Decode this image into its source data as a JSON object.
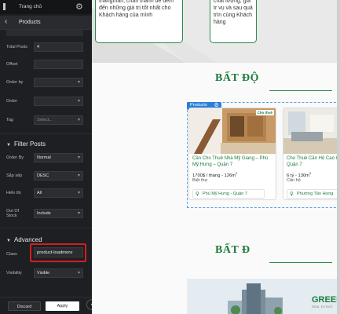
{
  "topbar": {
    "title": "Trang chủ",
    "gear": "gear-icon"
  },
  "panel": {
    "back_icon": "chevron-left-icon",
    "title": "Products"
  },
  "query": {
    "fields": [
      {
        "label": "Total Posts",
        "value": "4"
      },
      {
        "label": "Offset",
        "value": ""
      },
      {
        "label": "Order by",
        "value": ""
      },
      {
        "label": "Order",
        "value": ""
      },
      {
        "label": "Tag",
        "value": "Select..."
      }
    ]
  },
  "filter": {
    "title": "Filter Posts",
    "fields": [
      {
        "label": "Order By",
        "value": "Normal"
      },
      {
        "label": "Sắp xếp",
        "value": "DESC"
      },
      {
        "label": "Hiển thị",
        "value": "All"
      },
      {
        "label": "Out Of Stock",
        "value": "Include"
      }
    ]
  },
  "advanced": {
    "title": "Advanced",
    "class_label": "Class",
    "class_value": "product-loadmore",
    "visibility_label": "Visibility",
    "visibility_value": "Visible"
  },
  "footer": {
    "discard": "Discard",
    "apply": "Apply",
    "collapse_icon": "chevron-left-icon"
  },
  "canvas": {
    "card1_text": "thẳngthắn, chân thành để đem đến những giá trị tốt nhất cho Khách hàng của mình",
    "card2_text": "chất lượng, giá tr vụ và sau quá trìn cùng Khách hàng",
    "heading1": "BẤT ĐỘ",
    "heading2": "BẤT Đ",
    "wrapper_tag": "Products",
    "products": [
      {
        "badge": "Cho thuê",
        "title": "Cần Cho Thuê Nhà Mỹ Giang – Phú Mỹ Hưng – Quận 7",
        "price": "1700$ / tháng",
        "area": "126m",
        "area_sup": "2",
        "type": "Biệt thự",
        "location": "Phú Mỹ Hưng - Quận 7"
      },
      {
        "badge": "",
        "title": "Cho Thuê Căn Hộ Cao Cấ Quận 7",
        "price": "6 tỷ",
        "area": "130m",
        "area_sup": "2",
        "type": "Căn hộ",
        "location": "Phường Tân Hưng"
      }
    ],
    "bottom_brand": "GREEN",
    "bottom_brand_sub": "REAL ESTATE",
    "accent": "#1d7a3c"
  }
}
